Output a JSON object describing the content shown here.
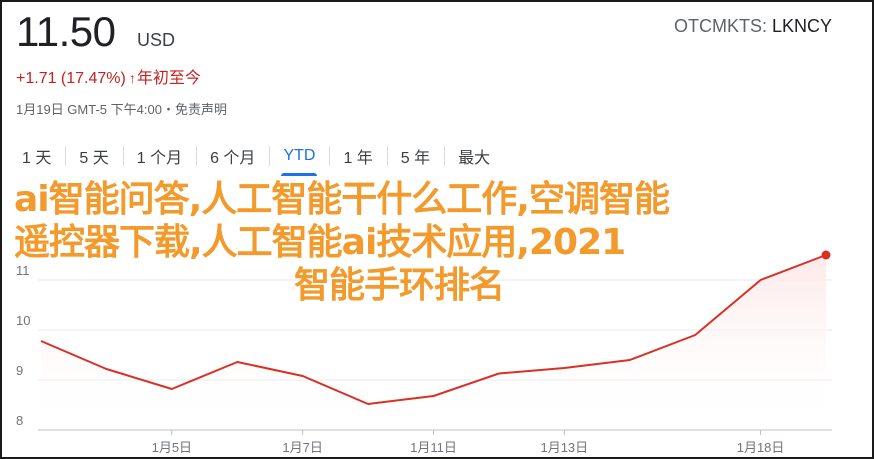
{
  "quote": {
    "price": "11.50",
    "currency": "USD",
    "exchange": "OTCMKTS: ",
    "symbol": "LKNCY",
    "change_text": "+1.71 (17.47%)",
    "change_arrow": "↑",
    "change_period": "年初至今",
    "as_of": "1月19日 GMT-5 下午4:00・免责声明"
  },
  "range_tabs": [
    "1 天",
    "5 天",
    "1 个月",
    "6 个月",
    "YTD",
    "1 年",
    "5 年",
    "最大"
  ],
  "active_tab": "YTD",
  "overlay": {
    "line1": "ai智能问答,人工智能干什么工作,空调智能",
    "line2": "遥控器下载,人工智能ai技术应用,2021",
    "line3": "智能手环排名"
  },
  "colors": {
    "line": "#d93025",
    "fill": "#fce8e6",
    "accent": "#1a73e8",
    "negative": "#c5221f",
    "overlay_text": "#f39a2c"
  },
  "chart_data": {
    "type": "area",
    "x": [
      "1月2日",
      "1月4日",
      "1月5日",
      "1月6日",
      "1月7日",
      "1月8日",
      "1月11日",
      "1月12日",
      "1月13日",
      "1月14日",
      "1月15日",
      "1月18日",
      "1月19日"
    ],
    "values": [
      9.78,
      9.22,
      8.82,
      9.36,
      9.08,
      8.52,
      8.68,
      9.13,
      9.24,
      9.4,
      9.9,
      11.0,
      11.5
    ],
    "y_ticks": [
      "8",
      "9",
      "10",
      "11"
    ],
    "x_tick_labels": [
      "1月5日",
      "1月7日",
      "1月11日",
      "1月13日",
      "1月18日"
    ],
    "ylim": [
      8,
      12
    ],
    "grid": true,
    "title": "",
    "xlabel": "",
    "ylabel": ""
  }
}
